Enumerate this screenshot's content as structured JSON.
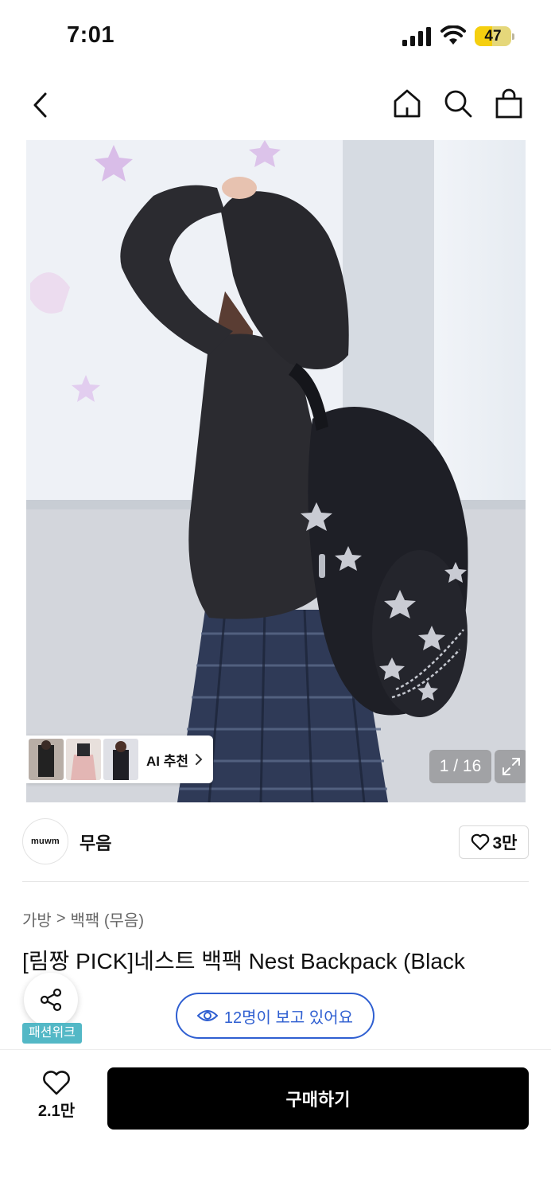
{
  "status_bar": {
    "time": "7:01",
    "battery_level": "47",
    "battery_fraction": 0.47,
    "signal_icon": "cellular-signal-icon",
    "wifi_icon": "wifi-icon"
  },
  "nav": {
    "back_icon": "chevron-left-icon",
    "home_icon": "home-icon",
    "search_icon": "search-icon",
    "bag_icon": "shopping-bag-icon"
  },
  "gallery": {
    "counter": "1 / 16",
    "ai_recommend_label": "AI 추천",
    "expand_icon": "expand-icon"
  },
  "brand": {
    "logo_text": "muwm",
    "name": "무음",
    "like_count": "3만",
    "like_icon": "heart-outline-icon"
  },
  "breadcrumb": {
    "category": "가방",
    "separator": ">",
    "subcategory": "백팩 (무음)"
  },
  "product": {
    "title": "[림짱 PICK]네스트 백팩 Nest Backpack (Black",
    "viewers_text": "12명이 보고 있어요",
    "badge": "패션위크",
    "share_icon": "share-icon"
  },
  "bottom_bar": {
    "wishlist_count": "2.1만",
    "buy_label": "구매하기"
  },
  "colors": {
    "accent_blue": "#2f5fd1",
    "badge_teal": "#53b8c6",
    "battery_yellow": "#f5cf0f",
    "buy_button": "#000000"
  }
}
